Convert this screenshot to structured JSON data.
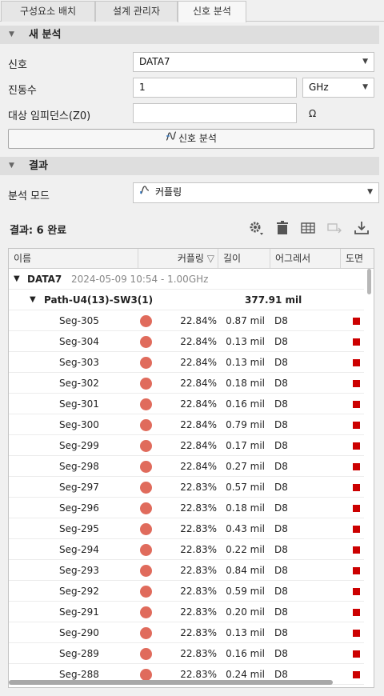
{
  "tabs": [
    {
      "label": "구성요소 배치"
    },
    {
      "label": "설계 관리자"
    },
    {
      "label": "신호 분석"
    }
  ],
  "new_analysis": {
    "title": "새 분석",
    "signal_label": "신호",
    "signal_value": "DATA7",
    "frequency_label": "진동수",
    "frequency_value": "1",
    "frequency_unit": "GHz",
    "impedance_label": "대상 임피던스(Z0)",
    "impedance_value": "",
    "impedance_unit": "Ω",
    "analyze_button": "신호 분석"
  },
  "results": {
    "title": "결과",
    "mode_label": "분석 모드",
    "mode_value": "커플링",
    "status": "결과: 6 완료",
    "columns": [
      "이름",
      "커플링",
      "길이",
      "어그레서",
      "도면"
    ],
    "group": {
      "name": "DATA7",
      "meta": "2024-05-09 10:54 - 1.00GHz"
    },
    "path": {
      "name": "Path-U4(13)-SW3(1)",
      "length": "377.91 mil"
    },
    "rows": [
      {
        "name": "Seg-305",
        "coupling": "22.84%",
        "length": "0.87 mil",
        "aggressor": "D8"
      },
      {
        "name": "Seg-304",
        "coupling": "22.84%",
        "length": "0.13 mil",
        "aggressor": "D8"
      },
      {
        "name": "Seg-303",
        "coupling": "22.84%",
        "length": "0.13 mil",
        "aggressor": "D8"
      },
      {
        "name": "Seg-302",
        "coupling": "22.84%",
        "length": "0.18 mil",
        "aggressor": "D8"
      },
      {
        "name": "Seg-301",
        "coupling": "22.84%",
        "length": "0.16 mil",
        "aggressor": "D8"
      },
      {
        "name": "Seg-300",
        "coupling": "22.84%",
        "length": "0.79 mil",
        "aggressor": "D8"
      },
      {
        "name": "Seg-299",
        "coupling": "22.84%",
        "length": "0.17 mil",
        "aggressor": "D8"
      },
      {
        "name": "Seg-298",
        "coupling": "22.84%",
        "length": "0.27 mil",
        "aggressor": "D8"
      },
      {
        "name": "Seg-297",
        "coupling": "22.83%",
        "length": "0.57 mil",
        "aggressor": "D8"
      },
      {
        "name": "Seg-296",
        "coupling": "22.83%",
        "length": "0.18 mil",
        "aggressor": "D8"
      },
      {
        "name": "Seg-295",
        "coupling": "22.83%",
        "length": "0.43 mil",
        "aggressor": "D8"
      },
      {
        "name": "Seg-294",
        "coupling": "22.83%",
        "length": "0.22 mil",
        "aggressor": "D8"
      },
      {
        "name": "Seg-293",
        "coupling": "22.83%",
        "length": "0.84 mil",
        "aggressor": "D8"
      },
      {
        "name": "Seg-292",
        "coupling": "22.83%",
        "length": "0.59 mil",
        "aggressor": "D8"
      },
      {
        "name": "Seg-291",
        "coupling": "22.83%",
        "length": "0.20 mil",
        "aggressor": "D8"
      },
      {
        "name": "Seg-290",
        "coupling": "22.83%",
        "length": "0.13 mil",
        "aggressor": "D8"
      },
      {
        "name": "Seg-289",
        "coupling": "22.83%",
        "length": "0.16 mil",
        "aggressor": "D8"
      },
      {
        "name": "Seg-288",
        "coupling": "22.83%",
        "length": "0.24 mil",
        "aggressor": "D8"
      }
    ]
  },
  "colors": {
    "coupling_dot": "#e06b5c",
    "drawing_marker": "#cc0000"
  },
  "icons": [
    "chevron-down-icon",
    "waveform-icon",
    "coupling-icon",
    "gear-icon",
    "trash-icon",
    "table-icon",
    "export-icon",
    "download-icon",
    "sort-filter-icon",
    "expand-triangle-icon"
  ]
}
